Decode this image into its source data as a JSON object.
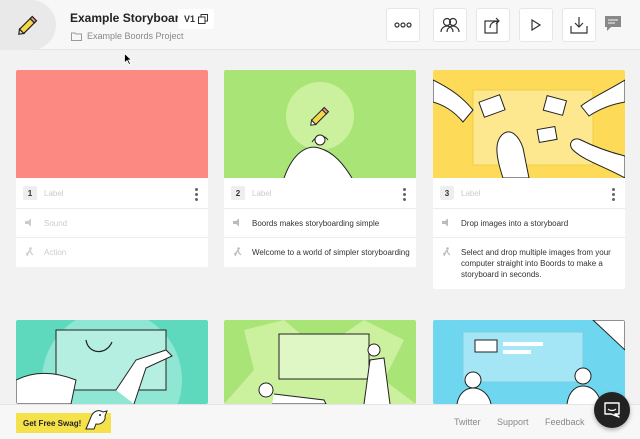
{
  "header": {
    "title": "Example Storyboard",
    "version": "V1",
    "project": "Example Boords Project"
  },
  "toolbar": {
    "buttons": [
      {
        "name": "more-options",
        "icon": "ellipsis-icon"
      },
      {
        "name": "collaborators",
        "icon": "people-icon"
      },
      {
        "name": "share",
        "icon": "share-icon"
      },
      {
        "name": "play",
        "icon": "play-icon"
      },
      {
        "name": "export",
        "icon": "download-icon"
      }
    ],
    "comment_icon": "comment-icon"
  },
  "frames": [
    {
      "number": "1",
      "color": "#fd8a82",
      "label": "Label",
      "sound": "Sound",
      "action": "Action",
      "label_empty": true,
      "sound_empty": true,
      "action_empty": true
    },
    {
      "number": "2",
      "color": "#a9e476",
      "label": "Label",
      "sound": "Boords makes storyboarding simple",
      "action": "Welcome to a world of simpler storyboarding",
      "label_empty": true,
      "sound_empty": false,
      "action_empty": false
    },
    {
      "number": "3",
      "color": "#fddb58",
      "label": "Label",
      "sound": "Drop images into a storyboard",
      "action": "Select and drop multiple images from your computer straight into Boords to make a storyboard in seconds.",
      "label_empty": true,
      "sound_empty": false,
      "action_empty": false
    }
  ],
  "frames_row2_colors": [
    "#5fd9be",
    "#a9e476",
    "#6ed6ee"
  ],
  "footer": {
    "swag": "Get Free Swag!",
    "links": [
      "Twitter",
      "Support",
      "Feedback"
    ]
  }
}
